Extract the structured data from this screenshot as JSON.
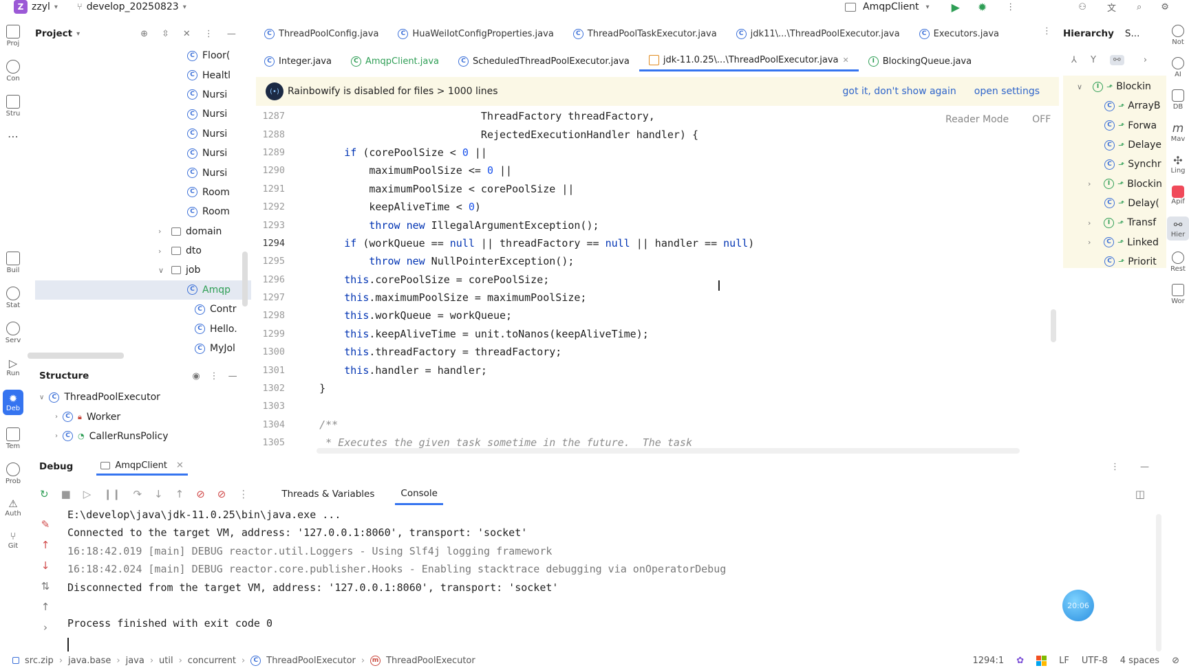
{
  "titlebar": {
    "project_letter": "Z",
    "project_name": "zzyl",
    "branch": "develop_20250823",
    "run_config": "AmqpClient"
  },
  "project_panel": {
    "title": "Project",
    "files": [
      {
        "name": "Floor(",
        "indent": 300
      },
      {
        "name": "Healtl",
        "indent": 300
      },
      {
        "name": "Nursi",
        "indent": 300
      },
      {
        "name": "Nursi",
        "indent": 300
      },
      {
        "name": "Nursi",
        "indent": 300
      },
      {
        "name": "Nursi",
        "indent": 300
      },
      {
        "name": "Nursi",
        "indent": 300
      },
      {
        "name": "Room",
        "indent": 300
      },
      {
        "name": "Room",
        "indent": 300
      }
    ],
    "folders": [
      {
        "name": "domain"
      },
      {
        "name": "dto"
      },
      {
        "name": "job"
      }
    ],
    "job_files": [
      {
        "name": "Amqp",
        "selected": true
      },
      {
        "name": "Contr"
      },
      {
        "name": "Hello."
      },
      {
        "name": "MyJol"
      }
    ]
  },
  "structure_panel": {
    "title": "Structure",
    "root": "ThreadPoolExecutor",
    "children": [
      "Worker",
      "CallerRunsPolicy"
    ]
  },
  "editor": {
    "tabs_row1": [
      "ThreadPoolConfig.java",
      "HuaWeiIotConfigProperties.java",
      "ThreadPoolTaskExecutor.java",
      "jdk11\\...\\ThreadPoolExecutor.java",
      "Executors.java"
    ],
    "tabs_row2": [
      "Integer.java",
      "AmqpClient.java",
      "ScheduledThreadPoolExecutor.java",
      "jdk-11.0.25\\...\\ThreadPoolExecutor.java",
      "BlockingQueue.java"
    ],
    "active_tab": "jdk-11.0.25\\...\\ThreadPoolExecutor.java",
    "banner": {
      "message": "Rainbowify is disabled for files > 1000 lines",
      "action1": "got it, don't show again",
      "action2": "open settings"
    },
    "reader_mode": "Reader Mode",
    "reader_state": "OFF",
    "lines": [
      {
        "n": "1287",
        "t": "                              ThreadFactory threadFactory,"
      },
      {
        "n": "1288",
        "t": "                              RejectedExecutionHandler handler) {"
      },
      {
        "n": "1289",
        "t": "        if (corePoolSize < 0 ||"
      },
      {
        "n": "1290",
        "t": "            maximumPoolSize <= 0 ||"
      },
      {
        "n": "1291",
        "t": "            maximumPoolSize < corePoolSize ||"
      },
      {
        "n": "1292",
        "t": "            keepAliveTime < 0)"
      },
      {
        "n": "1293",
        "t": "            throw new IllegalArgumentException();"
      },
      {
        "n": "1294",
        "t": "        if (workQueue == null || threadFactory == null || handler == null)"
      },
      {
        "n": "1295",
        "t": "            throw new NullPointerException();"
      },
      {
        "n": "1296",
        "t": "        this.corePoolSize = corePoolSize;"
      },
      {
        "n": "1297",
        "t": "        this.maximumPoolSize = maximumPoolSize;"
      },
      {
        "n": "1298",
        "t": "        this.workQueue = workQueue;"
      },
      {
        "n": "1299",
        "t": "        this.keepAliveTime = unit.toNanos(keepAliveTime);"
      },
      {
        "n": "1300",
        "t": "        this.threadFactory = threadFactory;"
      },
      {
        "n": "1301",
        "t": "        this.handler = handler;"
      },
      {
        "n": "1302",
        "t": "    }"
      },
      {
        "n": "1303",
        "t": ""
      },
      {
        "n": "1304",
        "t": "    /**"
      },
      {
        "n": "1305",
        "t": "     * Executes the given task sometime in the future.  The task"
      }
    ]
  },
  "hierarchy": {
    "title": "Hierarchy",
    "tab2": "S...",
    "items": [
      {
        "name": "Blockin",
        "kind": "I",
        "expand": "v"
      },
      {
        "name": "ArrayB",
        "kind": "C"
      },
      {
        "name": "Forwa",
        "kind": "C"
      },
      {
        "name": "Delaye",
        "kind": "C"
      },
      {
        "name": "Synchr",
        "kind": "C"
      },
      {
        "name": "Blockin",
        "kind": "I",
        "expand": ">"
      },
      {
        "name": "Delay(",
        "kind": "C"
      },
      {
        "name": "Transf",
        "kind": "I",
        "expand": ">"
      },
      {
        "name": "Linked",
        "kind": "C",
        "expand": ">"
      },
      {
        "name": "Priorit",
        "kind": "C"
      }
    ]
  },
  "debug": {
    "title": "Debug",
    "session": "AmqpClient",
    "tabs": [
      "Threads & Variables",
      "Console"
    ],
    "active": "Console",
    "console": [
      "E:\\develop\\java\\jdk-11.0.25\\bin\\java.exe ...",
      "Connected to the target VM, address: '127.0.0.1:8060', transport: 'socket'",
      "16:18:42.019 [main] DEBUG reactor.util.Loggers - Using Slf4j logging framework",
      "16:18:42.024 [main] DEBUG reactor.core.publisher.Hooks - Enabling stacktrace debugging via onOperatorDebug",
      "Disconnected from the target VM, address: '127.0.0.1:8060', transport: 'socket'",
      "",
      "Process finished with exit code 0"
    ],
    "timer": "20:06"
  },
  "leftbar": [
    "Proj",
    "Con",
    "Stru",
    "",
    "Buil",
    "Stat",
    "Serv",
    "Run",
    "Deb",
    "Tem",
    "Prob",
    "Auth",
    "Git"
  ],
  "rightbar": [
    "Not",
    "AI",
    "DB",
    "Mav",
    "Ling",
    "Apif",
    "Hier",
    "Rest",
    "Wor"
  ],
  "status": {
    "crumbs": [
      "src.zip",
      "java.base",
      "java",
      "util",
      "concurrent",
      "ThreadPoolExecutor",
      "ThreadPoolExecutor"
    ],
    "pos": "1294:1",
    "eol": "LF",
    "enc": "UTF-8",
    "indent": "4 spaces"
  }
}
